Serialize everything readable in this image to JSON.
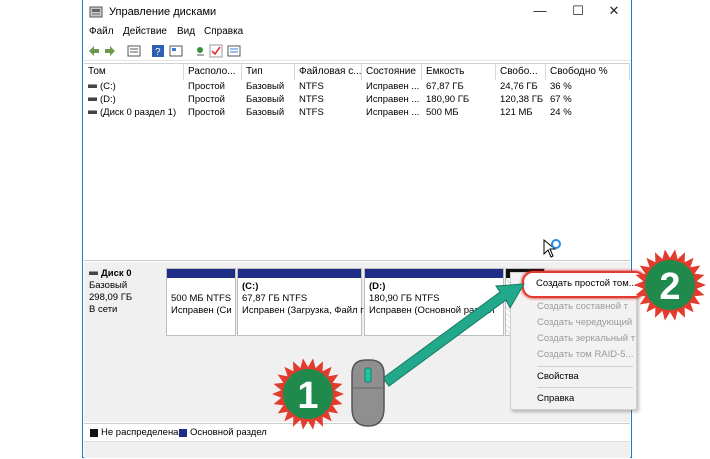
{
  "window": {
    "title": "Управление дисками",
    "controls": {
      "minimize": "—",
      "maximize": "☐",
      "close": "✕"
    }
  },
  "menu": [
    "Файл",
    "Действие",
    "Вид",
    "Справка"
  ],
  "toolbar": {
    "icons": [
      "back-icon",
      "forward-icon",
      "list-view-icon",
      "help-icon",
      "properties-icon",
      "connect-icon",
      "check-icon",
      "settings-icon"
    ]
  },
  "volume_table": {
    "columns": [
      "Том",
      "Располо...",
      "Тип",
      "Файловая с...",
      "Состояние",
      "Емкость",
      "Свобо...",
      "Свободно %"
    ],
    "rows": [
      [
        "(C:)",
        "Простой",
        "Базовый",
        "NTFS",
        "Исправен ...",
        "67,87 ГБ",
        "24,76 ГБ",
        "36 %"
      ],
      [
        "(D:)",
        "Простой",
        "Базовый",
        "NTFS",
        "Исправен ...",
        "180,90 ГБ",
        "120,38 ГБ",
        "67 %"
      ],
      [
        "(Диск 0 раздел 1)",
        "Простой",
        "Базовый",
        "NTFS",
        "Исправен ...",
        "500 МБ",
        "121 МБ",
        "24 %"
      ]
    ]
  },
  "disk": {
    "name": "Диск 0",
    "type": "Базовый",
    "size": "298,09 ГБ",
    "status": "В сети"
  },
  "partitions": [
    {
      "title": "",
      "size": "500 МБ NTFS",
      "status": "Исправен (Си"
    },
    {
      "title": "(C:)",
      "size": "67,87 ГБ NTFS",
      "status": "Исправен (Загрузка, Файл г"
    },
    {
      "title": "(D:)",
      "size": "180,90 ГБ NTFS",
      "status": "Исправен (Основной раздел"
    }
  ],
  "context_menu": {
    "items": [
      {
        "label": "Создать простой том...",
        "enabled": true
      },
      {
        "label": "Создать составной т",
        "enabled": false
      },
      {
        "label": "Создать чередующий",
        "enabled": false
      },
      {
        "label": "Создать зеркальный т",
        "enabled": false
      },
      {
        "label": "Создать том RAID-5...",
        "enabled": false
      },
      {
        "label": "Свойства",
        "enabled": true
      },
      {
        "label": "Справка",
        "enabled": true
      }
    ]
  },
  "legend": {
    "unallocated": "Не распределена",
    "primary": "Основной раздел"
  },
  "annotations": {
    "step1": "1",
    "step2": "2"
  },
  "colors": {
    "primary_partition": "#1e2d86",
    "unallocated": "#111111",
    "highlight": "#e23c2e",
    "badge_green": "#1f8a4c",
    "badge_spikes": "#e23c2e",
    "arrow": "#22a88a"
  }
}
